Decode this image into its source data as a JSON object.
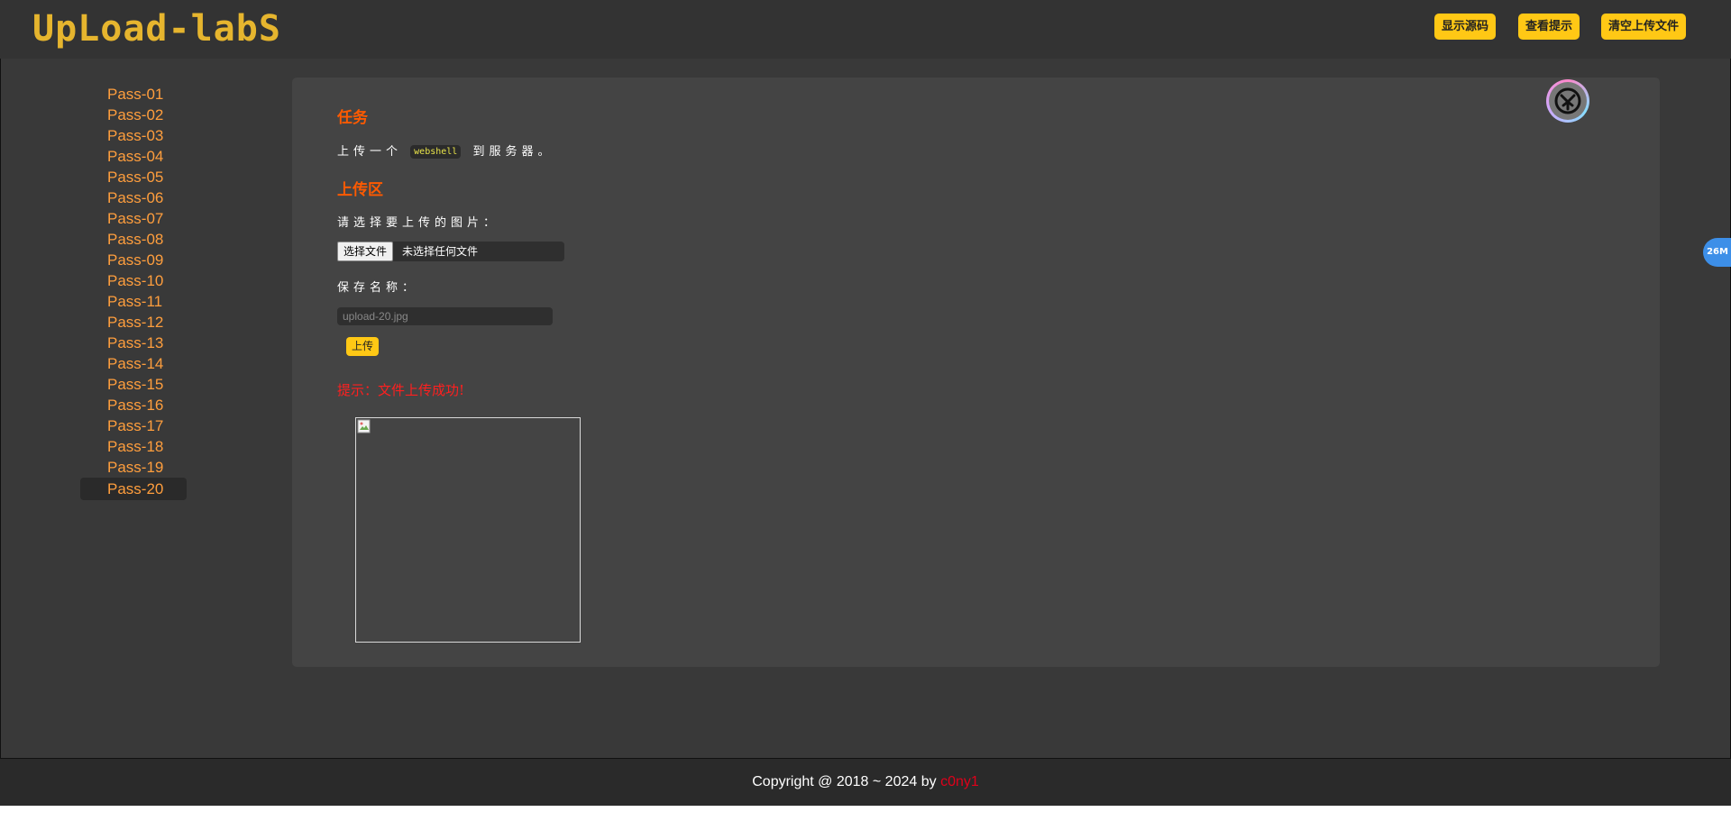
{
  "header": {
    "logo": "UpLoad-labS",
    "buttons": [
      "显示源码",
      "查看提示",
      "清空上传文件"
    ]
  },
  "sidebar": {
    "items": [
      "Pass-01",
      "Pass-02",
      "Pass-03",
      "Pass-04",
      "Pass-05",
      "Pass-06",
      "Pass-07",
      "Pass-08",
      "Pass-09",
      "Pass-10",
      "Pass-11",
      "Pass-12",
      "Pass-13",
      "Pass-14",
      "Pass-15",
      "Pass-16",
      "Pass-17",
      "Pass-18",
      "Pass-19",
      "Pass-20"
    ],
    "active": "Pass-20"
  },
  "main": {
    "task_title": "任务",
    "task_text_before": "上传一个",
    "task_code": "webshell",
    "task_text_after": "到服务器。",
    "upload_title": "上传区",
    "choose_label": "请选择要上传的图片：",
    "file_button": "选择文件",
    "file_status": "未选择任何文件",
    "save_name_label": "保存名称：",
    "save_name_placeholder": "upload-20.jpg",
    "upload_button": "上传",
    "message": "提示：文件上传成功!"
  },
  "widgets": {
    "side_pill": "26M"
  },
  "footer": {
    "text": "Copyright @ 2018 ~ 2024 by ",
    "author": "c0ny1"
  }
}
